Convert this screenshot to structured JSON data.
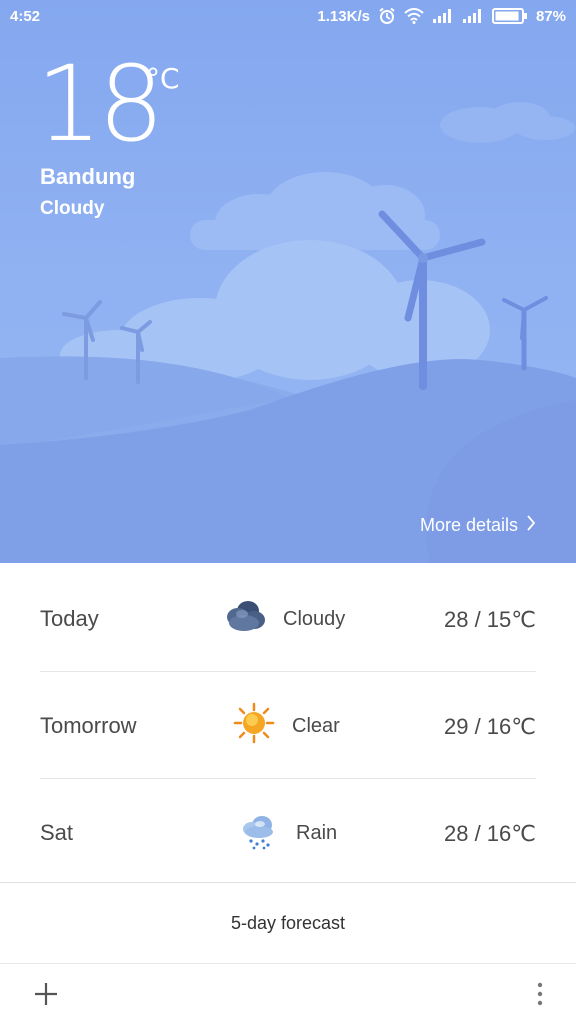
{
  "status_bar": {
    "time": "4:52",
    "network_speed": "1.13K/s",
    "battery": "87%",
    "icons": [
      "alarm-icon",
      "wifi-icon",
      "signal-icon",
      "signal-icon",
      "battery-icon"
    ]
  },
  "current": {
    "temperature": "18",
    "unit": "°C",
    "city": "Bandung",
    "condition": "Cloudy",
    "more_details": "More details"
  },
  "forecast": [
    {
      "day": "Today",
      "icon": "cloudy-icon",
      "condition": "Cloudy",
      "range": "28 / 15℃"
    },
    {
      "day": "Tomorrow",
      "icon": "sun-icon",
      "condition": "Clear",
      "range": "29 / 16℃"
    },
    {
      "day": "Sat",
      "icon": "rain-icon",
      "condition": "Rain",
      "range": "28 / 16℃"
    }
  ],
  "five_day_label": "5-day forecast",
  "bottom_bar": {
    "add_icon": "plus-icon",
    "menu_icon": "more-vert-icon"
  },
  "colors": {
    "hero_top": "#84a7ef",
    "hero_bottom": "#98b8f3",
    "hill": "#7a9de6",
    "text_dark": "#4a4a4a",
    "divider": "#e6e6e6"
  }
}
